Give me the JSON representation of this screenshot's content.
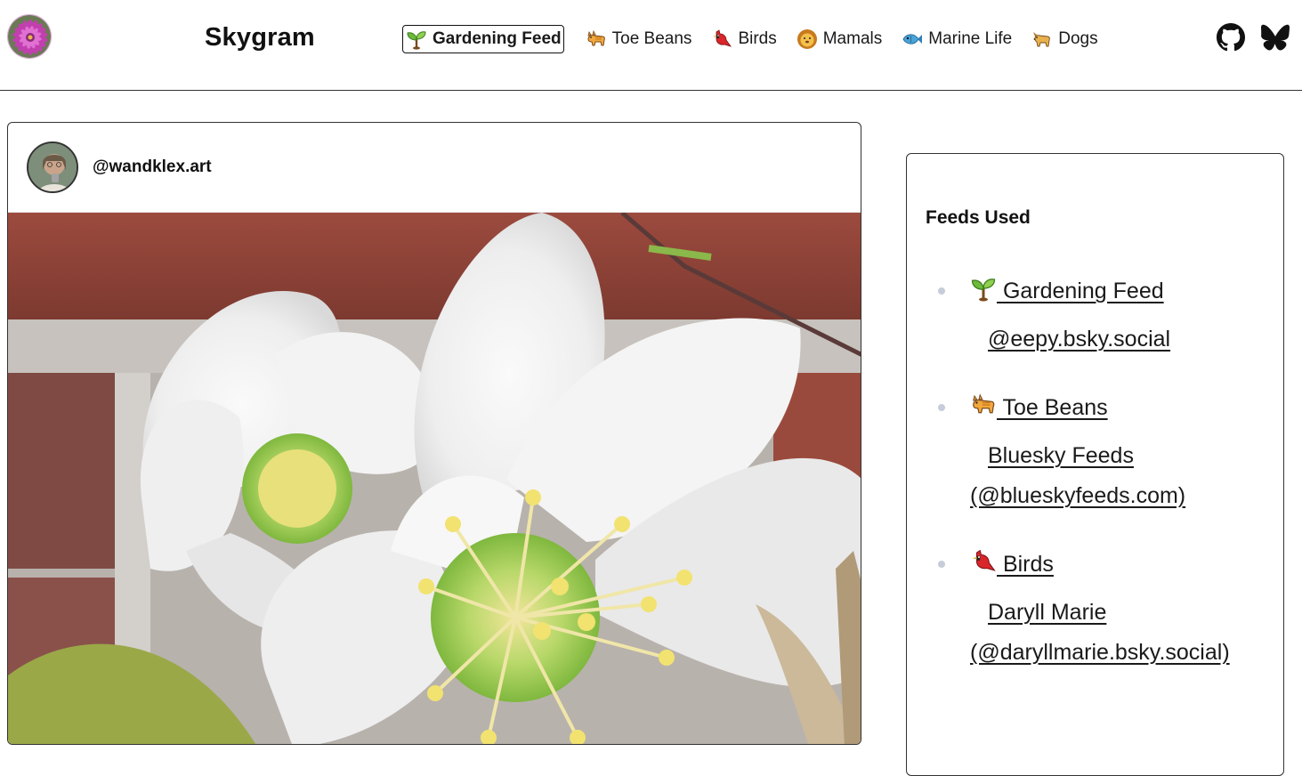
{
  "app": {
    "brand": "Skygram",
    "logo_icon": "zinnia-flower-logo"
  },
  "nav": {
    "items": [
      {
        "label": "Gardening Feed",
        "icon": "seedling-icon",
        "active": true
      },
      {
        "label": "Toe Beans",
        "icon": "cat-icon",
        "active": false
      },
      {
        "label": "Birds",
        "icon": "cardinal-bird-icon",
        "active": false
      },
      {
        "label": "Mamals",
        "icon": "lion-icon",
        "active": false
      },
      {
        "label": "Marine Life",
        "icon": "fish-icon",
        "active": false
      },
      {
        "label": "Dogs",
        "icon": "dog-icon",
        "active": false
      }
    ],
    "right_icons": [
      "github-icon",
      "bluesky-butterfly-icon"
    ]
  },
  "post": {
    "handle": "@wandklex.art",
    "image_icon": "white-hellebore-flower-photo"
  },
  "sidebar": {
    "title": "Feeds Used",
    "feeds": [
      {
        "name": "Gardening Feed",
        "icon": "seedling-icon",
        "author": "@eepy.bsky.social"
      },
      {
        "name": "Toe Beans",
        "icon": "cat-icon",
        "author": "Bluesky Feeds (@blueskyfeeds.com)"
      },
      {
        "name": "Birds",
        "icon": "cardinal-bird-icon",
        "author": "Daryll Marie (@daryllmarie.bsky.social)"
      }
    ]
  },
  "colors": {
    "border": "#333333",
    "text": "#111111",
    "bullet": "#c6ccd8"
  }
}
